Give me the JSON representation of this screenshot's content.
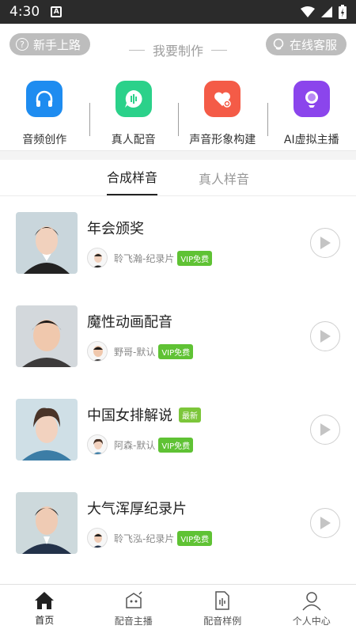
{
  "status_bar": {
    "time": "4:30",
    "notification_icon": "A"
  },
  "header": {
    "newbie_label": "新手上路",
    "center_title": "我要制作",
    "service_label": "在线客服"
  },
  "features": [
    {
      "label": "音频创作",
      "icon": "headphones-icon",
      "color": "#1e8cf0"
    },
    {
      "label": "真人配音",
      "icon": "chat-voice-icon",
      "color": "#2bd18a"
    },
    {
      "label": "声音形象构建",
      "icon": "heart-voice-icon",
      "color": "#f45b47"
    },
    {
      "label": "AI虚拟主播",
      "icon": "ai-anchor-icon",
      "color": "#8b45ec"
    }
  ],
  "tabs": [
    {
      "label": "合成样音",
      "active": true
    },
    {
      "label": "真人样音",
      "active": false
    }
  ],
  "samples": [
    {
      "title": "年会颁奖",
      "voice": "聆飞瀚-纪录片",
      "vip": "VIP免费",
      "new": ""
    },
    {
      "title": "魔性动画配音",
      "voice": "野哥-默认",
      "vip": "VIP免费",
      "new": ""
    },
    {
      "title": "中国女排解说",
      "voice": "阿森-默认",
      "vip": "VIP免费",
      "new": "最新"
    },
    {
      "title": "大气浑厚纪录片",
      "voice": "聆飞泓-纪录片",
      "vip": "VIP免费",
      "new": ""
    }
  ],
  "bottom_nav": [
    {
      "label": "首页",
      "icon": "home-icon",
      "active": true
    },
    {
      "label": "配音主播",
      "icon": "robot-icon",
      "active": false
    },
    {
      "label": "配音样例",
      "icon": "audio-file-icon",
      "active": false
    },
    {
      "label": "个人中心",
      "icon": "person-icon",
      "active": false
    }
  ]
}
